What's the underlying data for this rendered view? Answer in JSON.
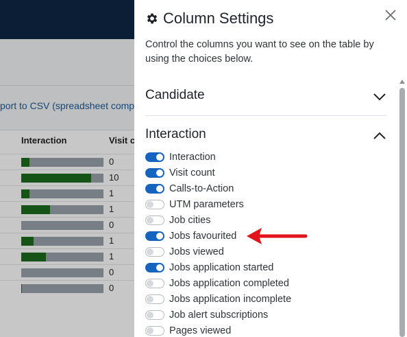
{
  "background": {
    "export_text": "port to CSV (spreadsheet comp",
    "table": {
      "headers": [
        "Interaction",
        "Visit c"
      ],
      "rows": [
        {
          "fill": 0.1,
          "value": "0"
        },
        {
          "fill": 0.85,
          "value": "10"
        },
        {
          "fill": 0.1,
          "value": "1"
        },
        {
          "fill": 0.35,
          "value": "1"
        },
        {
          "fill": 0.0,
          "value": "0"
        },
        {
          "fill": 0.15,
          "value": "1"
        },
        {
          "fill": 0.3,
          "value": "1"
        },
        {
          "fill": 0.0,
          "value": "0"
        },
        {
          "fill": 0.01,
          "value": "0"
        }
      ]
    }
  },
  "panel": {
    "title": "Column Settings",
    "description": "Control the columns you want to see on the table by using the choices below.",
    "sections": [
      {
        "label": "Candidate",
        "expanded": false
      },
      {
        "label": "Interaction",
        "expanded": true
      }
    ],
    "toggles": [
      {
        "label": "Interaction",
        "on": true
      },
      {
        "label": "Visit count",
        "on": true
      },
      {
        "label": "Calls-to-Action",
        "on": true
      },
      {
        "label": "UTM parameters",
        "on": false
      },
      {
        "label": "Job cities",
        "on": false
      },
      {
        "label": "Jobs favourited",
        "on": true
      },
      {
        "label": "Jobs viewed",
        "on": false
      },
      {
        "label": "Jobs application started",
        "on": true
      },
      {
        "label": "Jobs application completed",
        "on": false
      },
      {
        "label": "Jobs application incomplete",
        "on": false
      },
      {
        "label": "Job alert subscriptions",
        "on": false
      },
      {
        "label": "Pages viewed",
        "on": false
      }
    ]
  },
  "colors": {
    "toggle_on": "#1565c0",
    "bar_fill": "#1d6b1d",
    "annotation_arrow": "#e0141b",
    "topbar": "#0f2745"
  },
  "icons": {
    "title": "gear-icon",
    "close": "close-icon",
    "collapsed": "chevron-down-icon",
    "expanded": "chevron-up-icon"
  }
}
